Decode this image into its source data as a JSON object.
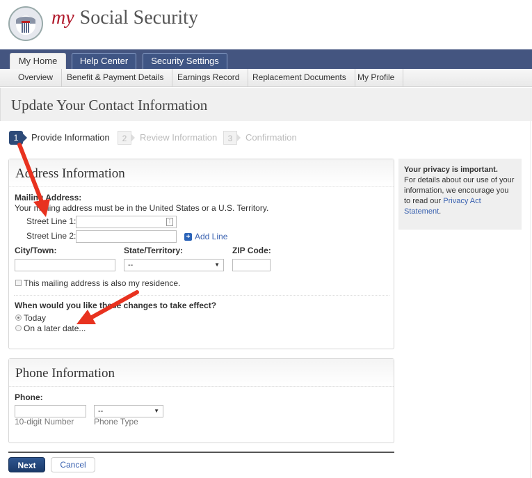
{
  "header": {
    "brand_prefix": "my",
    "brand_name": "Social Security",
    "logo": "ssa-seal-logo"
  },
  "nav": {
    "tabs": [
      {
        "label": "My Home",
        "active": true
      },
      {
        "label": "Help Center",
        "active": false
      },
      {
        "label": "Security Settings",
        "active": false
      }
    ],
    "subtabs": [
      {
        "label": "Overview"
      },
      {
        "label": "Benefit & Payment Details"
      },
      {
        "label": "Earnings Record"
      },
      {
        "label": "Replacement Documents"
      },
      {
        "label": "My Profile"
      }
    ]
  },
  "page": {
    "title": "Update Your Contact Information"
  },
  "steps": [
    {
      "num": "1",
      "label": "Provide Information",
      "active": true
    },
    {
      "num": "2",
      "label": "Review Information",
      "active": false
    },
    {
      "num": "3",
      "label": "Confirmation",
      "active": false
    }
  ],
  "address": {
    "title": "Address Information",
    "mailing_label": "Mailing Address:",
    "mailing_note": "Your mailing address must be in the United States or a U.S. Territory.",
    "street1_label": "Street Line 1:",
    "street1_value": "",
    "street2_label": "Street Line 2:",
    "street2_value": "",
    "add_line": "Add Line",
    "city_label": "City/Town:",
    "city_value": "",
    "state_label": "State/Territory:",
    "state_value": "--",
    "zip_label": "ZIP Code:",
    "zip_value": "",
    "residence_checkbox": "This mailing address is also my residence.",
    "residence_checked": false,
    "effect_question": "When would you like these changes to take effect?",
    "effect_options": [
      {
        "label": "Today",
        "selected": true
      },
      {
        "label": "On a later date...",
        "selected": false
      }
    ]
  },
  "phone": {
    "title": "Phone Information",
    "phone_label": "Phone:",
    "number_value": "",
    "number_hint": "10-digit Number",
    "type_value": "--",
    "type_hint": "Phone Type"
  },
  "privacy": {
    "heading": "Your privacy is important.",
    "body": "For details about our use of your information, we encourage you to read our",
    "link": "Privacy Act Statement",
    "after_link": "."
  },
  "actions": {
    "next": "Next",
    "cancel": "Cancel"
  },
  "colors": {
    "nav_bar": "#445580",
    "step_active": "#2d4a78",
    "brand_red": "#b0182a",
    "link": "#3a62b0",
    "annotation_arrow": "#e8321f"
  }
}
